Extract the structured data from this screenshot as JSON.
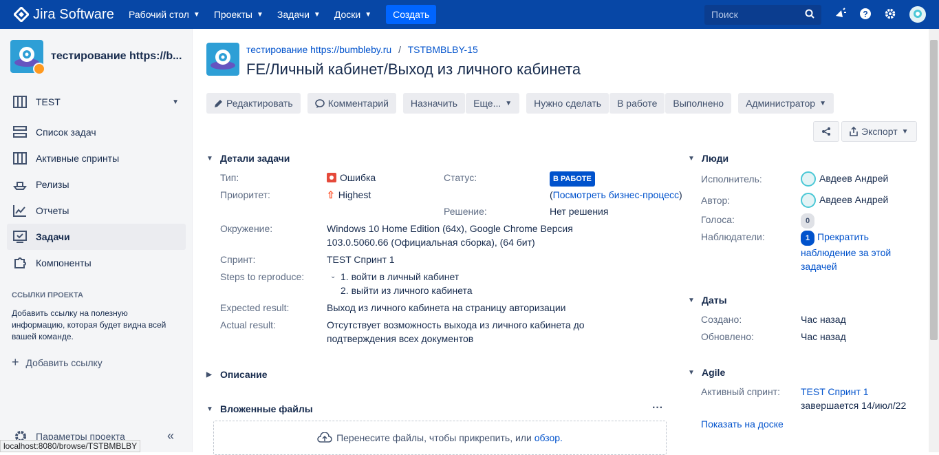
{
  "topbar": {
    "logo": "Jira Software",
    "nav": [
      {
        "label": "Рабочий стол"
      },
      {
        "label": "Проекты"
      },
      {
        "label": "Задачи"
      },
      {
        "label": "Доски"
      }
    ],
    "create": "Создать",
    "search_placeholder": "Поиск"
  },
  "sidebar": {
    "project_title": "тестирование https://b...",
    "board": "TEST",
    "items": [
      {
        "label": "Список задач",
        "icon": "backlog-icon"
      },
      {
        "label": "Активные спринты",
        "icon": "board-icon"
      },
      {
        "label": "Релизы",
        "icon": "ship-icon"
      },
      {
        "label": "Отчеты",
        "icon": "chart-icon"
      },
      {
        "label": "Задачи",
        "icon": "issues-icon"
      },
      {
        "label": "Компоненты",
        "icon": "puzzle-icon"
      }
    ],
    "links_header": "ССЫЛКИ ПРОЕКТА",
    "links_desc": "Добавить ссылку на полезную информацию, которая будет видна всей вашей команде.",
    "add_link": "Добавить ссылку",
    "params": "Параметры проекта",
    "status_url": "localhost:8080/browse/TSTBMBLBY"
  },
  "issue": {
    "breadcrumb_project": "тестирование https://bumbleby.ru",
    "breadcrumb_sep": "/",
    "key": "TSTBMBLBY-15",
    "summary": "FE/Личный кабинет/Выход из личного кабинета",
    "toolbar": {
      "edit": "Редактировать",
      "comment": "Комментарий",
      "assign": "Назначить",
      "more": "Еще...",
      "todo": "Нужно сделать",
      "inprogress": "В работе",
      "done": "Выполнено",
      "admin": "Администратор",
      "export": "Экспорт"
    },
    "details": {
      "header": "Детали задачи",
      "type_label": "Тип:",
      "type_value": "Ошибка",
      "priority_label": "Приоритет:",
      "priority_value": "Highest",
      "status_label": "Статус:",
      "status_value": "В РАБОТЕ",
      "workflow_open": "(",
      "workflow_link": "Посмотреть бизнес-процесс",
      "workflow_close": ")",
      "resolution_label": "Решение:",
      "resolution_value": "Нет решения",
      "env_label": "Окружение:",
      "env_value": "Windows 10 Home Edition (64x), Google Chrome Версия 103.0.5060.66 (Официальная сборка), (64 бит)",
      "sprint_label": "Спринт:",
      "sprint_value": "TEST Спринт 1",
      "steps_label": "Steps to reproduce:",
      "steps": [
        "1. войти в личный кабинет",
        "2. выйти из личного кабинета"
      ],
      "expected_label": "Expected result:",
      "expected_value": "Выход из личного кабинета на страницу авторизации",
      "actual_label": "Actual result:",
      "actual_value": "Отсутствует возможность выхода из личного кабинета до подтверждения всех документов"
    },
    "description_header": "Описание",
    "attachments_header": "Вложенные файлы",
    "dropzone_text": "Перенесите файлы, чтобы прикрепить, или",
    "dropzone_link": "обзор."
  },
  "people": {
    "header": "Люди",
    "assignee_label": "Исполнитель:",
    "assignee": "Авдеев Андрей",
    "reporter_label": "Автор:",
    "reporter": "Авдеев Андрей",
    "votes_label": "Голоса:",
    "votes": "0",
    "watchers_label": "Наблюдатели:",
    "watchers": "1",
    "watch_link": "Прекратить наблюдение за этой задачей"
  },
  "dates": {
    "header": "Даты",
    "created_label": "Создано:",
    "created": "Час назад",
    "updated_label": "Обновлено:",
    "updated": "Час назад"
  },
  "agile": {
    "header": "Agile",
    "sprint_label": "Активный спринт:",
    "sprint": "TEST Спринт 1",
    "ends": "завершается 14/июл/22",
    "board_link": "Показать на доске"
  }
}
